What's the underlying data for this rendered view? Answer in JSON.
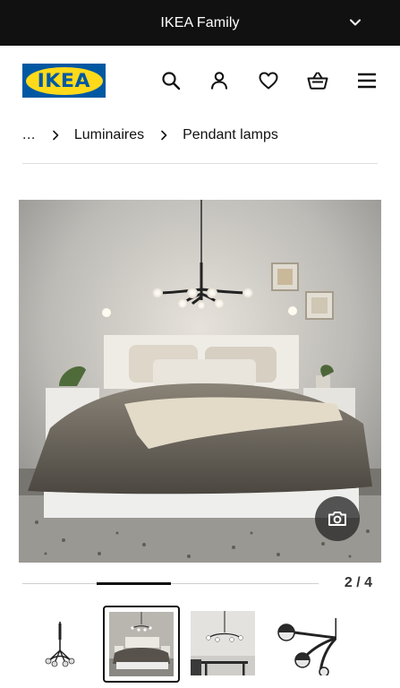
{
  "topbar": {
    "title": "IKEA Family",
    "chevron_icon": "chevron-down-icon"
  },
  "header": {
    "logo_text": "IKEA",
    "icons": [
      "search-icon",
      "user-icon",
      "heart-icon",
      "basket-icon",
      "menu-icon"
    ]
  },
  "breadcrumb": {
    "ellipsis": "...",
    "items": [
      "Luminaires",
      "Pendant lamps"
    ],
    "separator_icon": "chevron-right-icon"
  },
  "gallery": {
    "counter": "2 / 4",
    "progress": 0.25,
    "active_index": 1,
    "camera_icon": "camera-icon",
    "thumbnails": [
      "pendant-lamp-product",
      "bedroom-scene",
      "dining-scene",
      "lamp-closeup"
    ]
  },
  "colors": {
    "topbar_bg": "#111111",
    "logo_blue": "#0058a3",
    "logo_yellow": "#ffda1a"
  }
}
